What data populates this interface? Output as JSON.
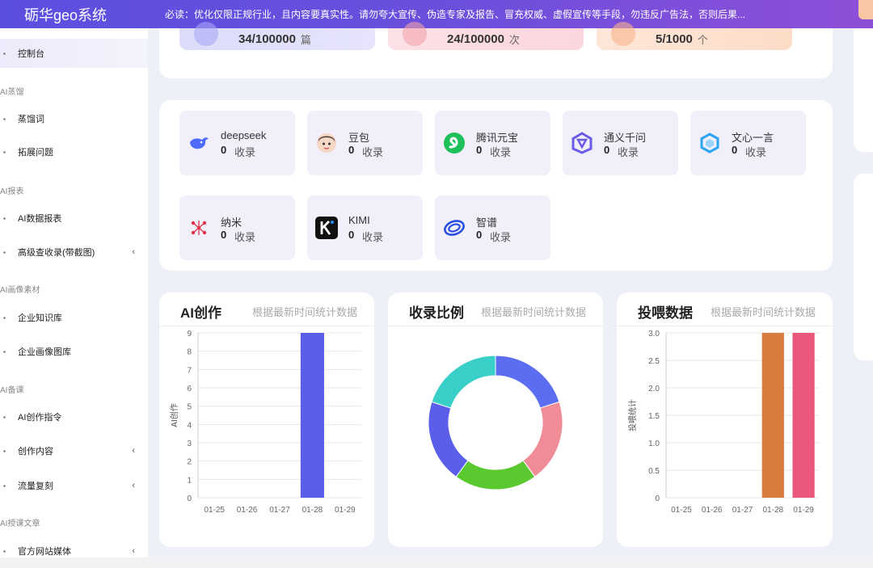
{
  "header": {
    "brand": "砺华geo系统",
    "notice": "必读：优化仅限正规行业，且内容要真实性。请勿夸大宣传、伪造专家及报告、冒充权威、虚假宣传等手段，勿违反广告法，否则后果..."
  },
  "sidebar": {
    "items": [
      {
        "label": "控制台",
        "active": true,
        "chevron": ""
      },
      {
        "group": "AI蒸馏"
      },
      {
        "label": "蒸馏词",
        "chevron": ""
      },
      {
        "label": "拓展问题",
        "chevron": ""
      },
      {
        "group": "AI报表"
      },
      {
        "label": "AI数据报表",
        "chevron": ""
      },
      {
        "label": "高级查收录(带截图)",
        "chevron": "‹"
      },
      {
        "group": "AI画像素材"
      },
      {
        "label": "企业知识库",
        "chevron": ""
      },
      {
        "label": "企业画像图库",
        "chevron": ""
      },
      {
        "group": "AI备课"
      },
      {
        "label": "AI创作指令",
        "chevron": ""
      },
      {
        "label": "创作内容",
        "chevron": "‹"
      },
      {
        "label": "流量复刻",
        "chevron": "‹"
      },
      {
        "group": "AI授课文章"
      },
      {
        "label": "官方网站媒体",
        "chevron": "‹"
      }
    ]
  },
  "stats": [
    {
      "value": "34/100000",
      "unit": "篇"
    },
    {
      "value": "24/100000",
      "unit": "次"
    },
    {
      "value": "5/1000",
      "unit": "个"
    }
  ],
  "models": [
    {
      "name": "deepseek",
      "count": "0",
      "label": "收录",
      "icon": "whale-icon"
    },
    {
      "name": "豆包",
      "count": "0",
      "label": "收录",
      "icon": "doubao-avatar-icon"
    },
    {
      "name": "腾讯元宝",
      "count": "0",
      "label": "收录",
      "icon": "yuanbao-icon"
    },
    {
      "name": "通义千问",
      "count": "0",
      "label": "收录",
      "icon": "tongyi-icon"
    },
    {
      "name": "文心一言",
      "count": "0",
      "label": "收录",
      "icon": "wenxin-icon"
    },
    {
      "name": "纳米",
      "count": "0",
      "label": "收录",
      "icon": "nami-icon"
    },
    {
      "name": "KIMI",
      "count": "0",
      "label": "收录",
      "icon": "kimi-icon"
    },
    {
      "name": "智谱",
      "count": "0",
      "label": "收录",
      "icon": "zhipu-icon"
    }
  ],
  "panels": {
    "ai_create": {
      "title": "AI创作",
      "subtitle": "根据最新时间统计数据"
    },
    "ratio": {
      "title": "收录比例",
      "subtitle": "根据最新时间统计数据"
    },
    "feed": {
      "title": "投喂数据",
      "subtitle": "根据最新时间统计数据"
    }
  },
  "chart_data": [
    {
      "type": "bar",
      "title": "AI创作",
      "ylabel": "AI创作",
      "categories": [
        "01-25",
        "01-26",
        "01-27",
        "01-28",
        "01-29"
      ],
      "values": [
        0,
        0,
        0,
        9,
        0
      ],
      "ylim": [
        0,
        9
      ],
      "yticks": [
        "0",
        "1",
        "2",
        "3",
        "4",
        "5",
        "6",
        "7",
        "8",
        "9"
      ],
      "colors": [
        "#5b5ee8"
      ]
    },
    {
      "type": "pie",
      "title": "收录比例",
      "donut": true,
      "values": [
        20,
        20,
        20,
        20,
        20
      ],
      "colors": [
        "#5b6df0",
        "#f08c98",
        "#5ac930",
        "#5b5ee8",
        "#38cfc8"
      ]
    },
    {
      "type": "bar",
      "title": "投喂数据",
      "ylabel": "投喂统计",
      "categories": [
        "01-25",
        "01-26",
        "01-27",
        "01-28",
        "01-29"
      ],
      "values": [
        0,
        0,
        0,
        3.0,
        3.0
      ],
      "ylim": [
        0,
        3.0
      ],
      "yticks": [
        "0",
        "0.5",
        "1.0",
        "1.5",
        "2.0",
        "2.5",
        "3.0"
      ],
      "colors": [
        "#d97a3e",
        "#e9587a"
      ]
    }
  ]
}
